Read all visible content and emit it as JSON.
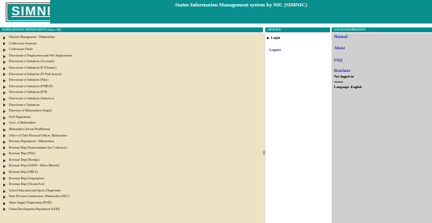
{
  "header": {
    "logo_text": "SIMNIC",
    "title": "Status Information Management system by NIC (SIMNIC)"
  },
  "columns": {
    "departments": "PARTICIPATING DEPARTMENTS (show All)",
    "options": "OPTIONS",
    "login_info": "LOGIN INFORMATION"
  },
  "departments": [
    "Disaster Management - Maharashtra",
    "Collectorate Amravati",
    "Collectorate Dhule",
    "Directorate of Employment and Self Employment",
    "Directorate of Industries (Accounts)",
    "Directorate of Industries (E.P branch)",
    "Directorate of Industries (IT Park branch)",
    "Directorate of Industries (Plan)",
    "Directorate of Industries (PMEGP)",
    "Directorate of Industries (PSI)",
    "Directorate of Industries (Statistics)",
    "Directorate of Industries",
    "Directory of Maharashtra (Sangli)",
    "EGS Department",
    "Govt. of Maharashtra",
    "Maharashtra Jeevan Pradhikaran",
    "Office of Chief Electoral Officer, Maharashtra",
    "Revenue Department - Maharashtra",
    "Revenue Dept (Entertainment Tax Collection)",
    "Revenue Dept (PAS)",
    "Revenue Dept (Receipt)",
    "Revenue Dept (SAND - Minor Mineral)",
    "Revenue Dept (SREA)",
    "Revenue Dept (Suspension)",
    "Revenue Dept (Vacant Post)",
    "School Education and Sports Department",
    "State Election Commission, Maharashtra (SEC)",
    "Water Supply Department (WSD)",
    "Urban Development Department (UDD)"
  ],
  "options": {
    "login": "Login",
    "logout": "Logout"
  },
  "login_info": {
    "manual": "Manual",
    "about": "About",
    "faq": "FAQ",
    "brochure": "Brochure",
    "status": "Not logged in",
    "language": "Language: English"
  },
  "colors": {
    "teal": "#0a8f8f",
    "beige": "#ede3c4",
    "grey": "#cfcfcf",
    "link": "#1e2fb3"
  },
  "icons": {
    "department_marker": "triangle-right-icon",
    "option_marker": "bullet-icon"
  }
}
